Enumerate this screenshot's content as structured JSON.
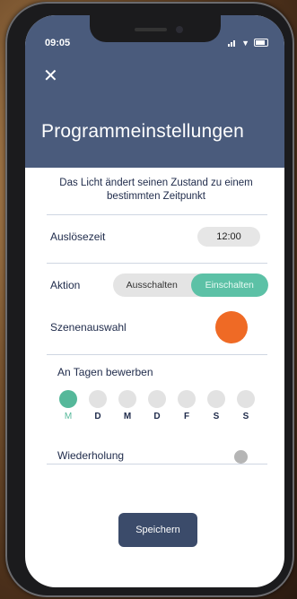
{
  "status_bar": {
    "time": "09:05"
  },
  "header": {
    "close_icon": "close-icon",
    "title": "Programmeinstellungen"
  },
  "description": "Das Licht ändert seinen Zustand zu einem bestimmten Zeitpunkt",
  "trigger_time": {
    "label": "Auslösezeit",
    "value": "12:00"
  },
  "action": {
    "label": "Aktion",
    "options": [
      {
        "label": "Ausschalten",
        "selected": false
      },
      {
        "label": "Einschalten",
        "selected": true
      }
    ]
  },
  "scene": {
    "label": "Szenenauswahl",
    "color": "#ef6a25"
  },
  "days": {
    "label": "An Tagen bewerben",
    "items": [
      {
        "label": "M",
        "active": true
      },
      {
        "label": "D",
        "active": false
      },
      {
        "label": "M",
        "active": false
      },
      {
        "label": "D",
        "active": false
      },
      {
        "label": "F",
        "active": false
      },
      {
        "label": "S",
        "active": false
      },
      {
        "label": "S",
        "active": false
      }
    ]
  },
  "repeat": {
    "label": "Wiederholung",
    "enabled": false
  },
  "save_button": {
    "label": "Speichern"
  },
  "colors": {
    "header": "#4a5b7c",
    "accent": "#5cc1a6",
    "scene": "#ef6a25",
    "button": "#3b4b6a"
  }
}
